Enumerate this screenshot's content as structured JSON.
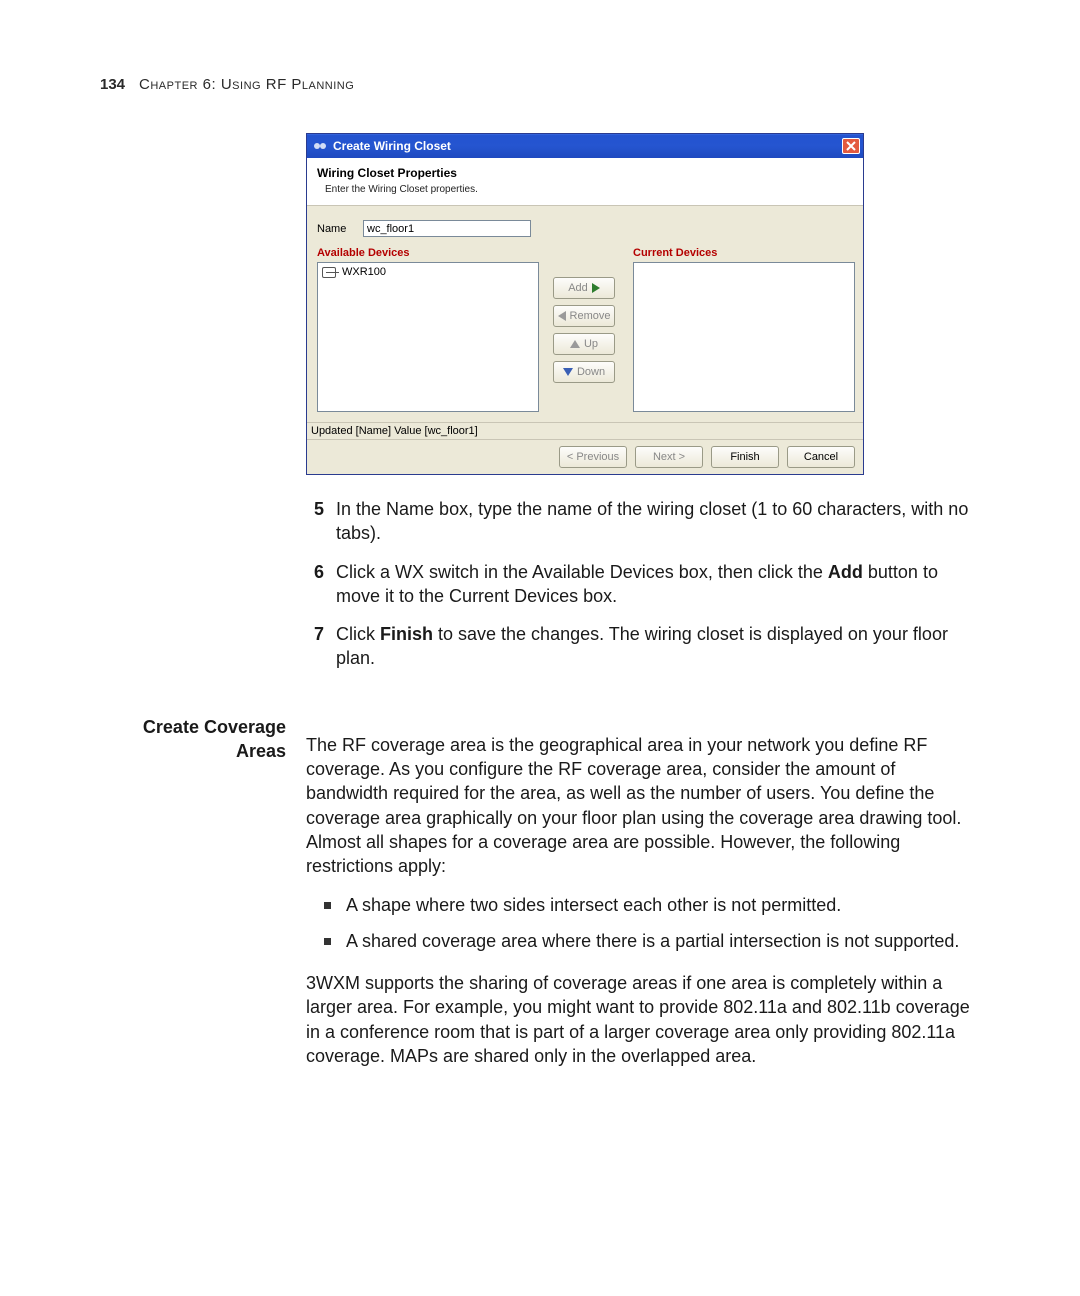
{
  "page": {
    "number": "134",
    "chapter_small_caps_prefix": "Chapter 6:",
    "chapter_small_caps_rest": "Using RF Planning"
  },
  "dialog": {
    "title": "Create Wiring Closet",
    "header_title": "Wiring Closet Properties",
    "header_sub": "Enter the Wiring Closet properties.",
    "name_label": "Name",
    "name_value": "wc_floor1",
    "available_heading": "Available Devices",
    "current_heading": "Current Devices",
    "available_items": [
      {
        "label": "WXR100"
      }
    ],
    "buttons": {
      "add": "Add",
      "remove": "Remove",
      "up": "Up",
      "down": "Down"
    },
    "status": "Updated [Name] Value [wc_floor1]",
    "footer": {
      "previous": "< Previous",
      "next": "Next >",
      "finish": "Finish",
      "cancel": "Cancel"
    }
  },
  "steps": {
    "s5_num": "5",
    "s5_text": "In the Name box, type the name of the wiring closet (1 to 60 characters, with no tabs).",
    "s6_num": "6",
    "s6_pre": "Click a WX switch in the Available Devices box, then click the ",
    "s6_bold": "Add",
    "s6_post": " button to move it to the Current Devices box.",
    "s7_num": "7",
    "s7_pre": "Click ",
    "s7_bold": "Finish",
    "s7_post": " to save the changes. The wiring closet is displayed on your floor plan."
  },
  "section": {
    "heading_line1": "Create Coverage",
    "heading_line2": "Areas",
    "para1": "The RF coverage area is the geographical area in your network you define RF coverage. As you configure the RF coverage area, consider the amount of bandwidth required for the area, as well as the number of users. You define the coverage area graphically on your floor plan using the coverage area drawing tool. Almost all shapes for a coverage area are possible. However, the following restrictions apply:",
    "bullets": [
      "A shape where two sides intersect each other is not permitted.",
      "A shared coverage area where there is a partial intersection is not supported."
    ],
    "para2": "3WXM supports the sharing of coverage areas if one area is completely within a larger area. For example, you might want to provide 802.11a and 802.11b coverage in a conference room that is part of a larger coverage area only providing 802.11a coverage. MAPs are shared only in the overlapped area."
  }
}
